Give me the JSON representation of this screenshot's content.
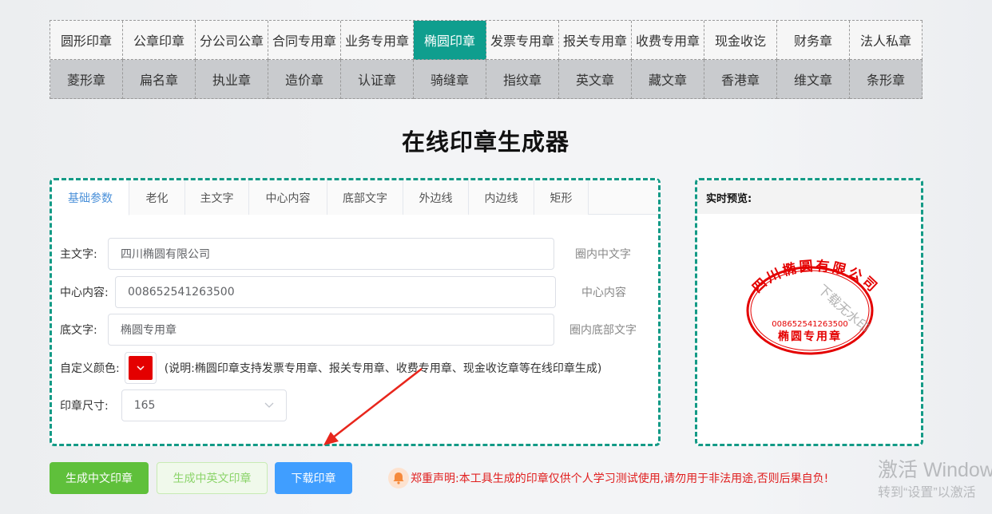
{
  "nav": {
    "row1": [
      "圆形印章",
      "公章印章",
      "分公司公章",
      "合同专用章",
      "业务专用章",
      "椭圆印章",
      "发票专用章",
      "报关专用章",
      "收费专用章",
      "现金收讫",
      "财务章",
      "法人私章"
    ],
    "row2": [
      "菱形章",
      "扁名章",
      "执业章",
      "造价章",
      "认证章",
      "骑缝章",
      "指纹章",
      "英文章",
      "藏文章",
      "香港章",
      "维文章",
      "条形章"
    ]
  },
  "page_title": "在线印章生成器",
  "tabs": [
    "基础参数",
    "老化",
    "主文字",
    "中心内容",
    "底部文字",
    "外边线",
    "内边线",
    "矩形"
  ],
  "form": {
    "main_text": {
      "label": "主文字:",
      "value": "四川椭圆有限公司",
      "hint": "圈内中文字"
    },
    "center": {
      "label": "中心内容:",
      "value": "008652541263500",
      "hint": "中心内容"
    },
    "bottom": {
      "label": "底文字:",
      "value": "椭圆专用章",
      "hint": "圈内底部文字"
    },
    "color": {
      "label": "自定义颜色:",
      "value": "#e40000",
      "note": "(说明:椭圆印章支持发票专用章、报关专用章、收费专用章、现金收讫章等在线印章生成)"
    },
    "size": {
      "label": "印章尺寸:",
      "value": "165"
    }
  },
  "preview": {
    "title": "实时预览:",
    "stamp_top_text": "四川椭圆有限公司",
    "stamp_center": "008652541263500",
    "stamp_bottom": "椭圆专用章",
    "watermark": "下载无水印",
    "stamp_color": "#e40000"
  },
  "buttons": {
    "gen_cn": "生成中文印章",
    "gen_cn_en": "生成中英文印章",
    "download": "下载印章"
  },
  "notice": "郑重声明:本工具生成的印章仅供个人学习测试使用,请勿用于非法用途,否则后果自负!",
  "windows_watermark": {
    "line1": "激活 Windows",
    "line2": "转到“设置”以激活"
  }
}
